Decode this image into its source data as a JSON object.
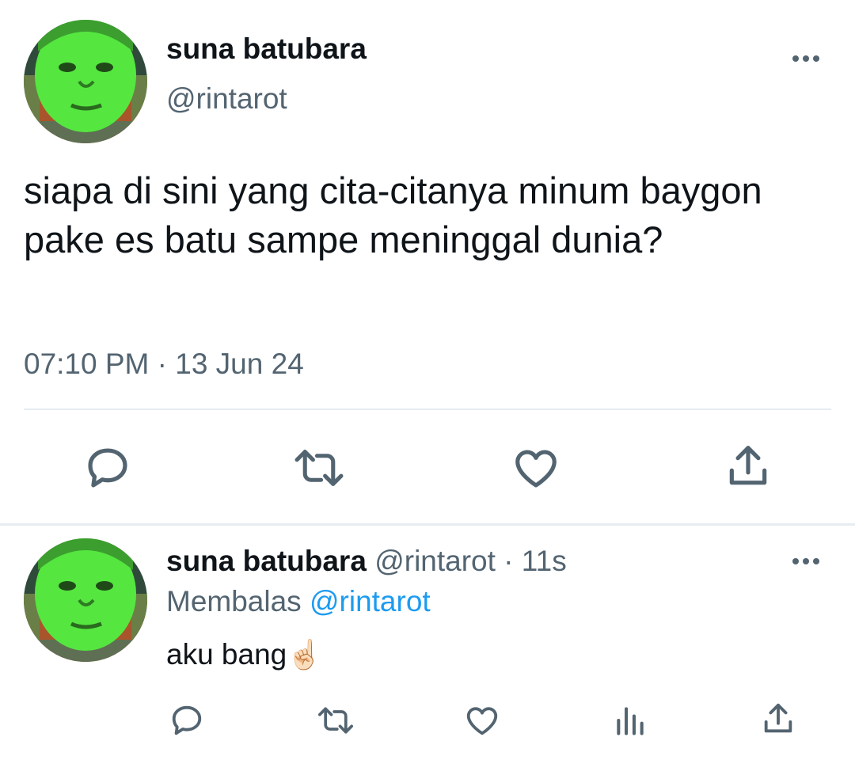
{
  "main_tweet": {
    "author_name": "suna batubara",
    "handle": "@rintarot",
    "text": "siapa di sini yang cita-citanya minum baygon pake es batu sampe meninggal dunia?",
    "timestamp": "07:10 PM · 13 Jun 24",
    "actions": [
      "reply-icon",
      "retweet-icon",
      "like-icon",
      "share-icon"
    ]
  },
  "reply_tweet": {
    "author_name": "suna batubara",
    "handle_time": "@rintarot · 11s",
    "replying_label": "Membalas",
    "replying_to": "@rintarot",
    "text": "aku bang",
    "emoji": "☝🏻",
    "actions": [
      "reply-icon",
      "retweet-icon",
      "like-icon",
      "views-icon",
      "share-icon"
    ]
  },
  "colors": {
    "text_primary": "#0f1419",
    "text_secondary": "#536471",
    "link": "#1d9bf0",
    "icon": "#536471",
    "divider": "#e6ecf0",
    "avatar_face": "#55e640"
  }
}
